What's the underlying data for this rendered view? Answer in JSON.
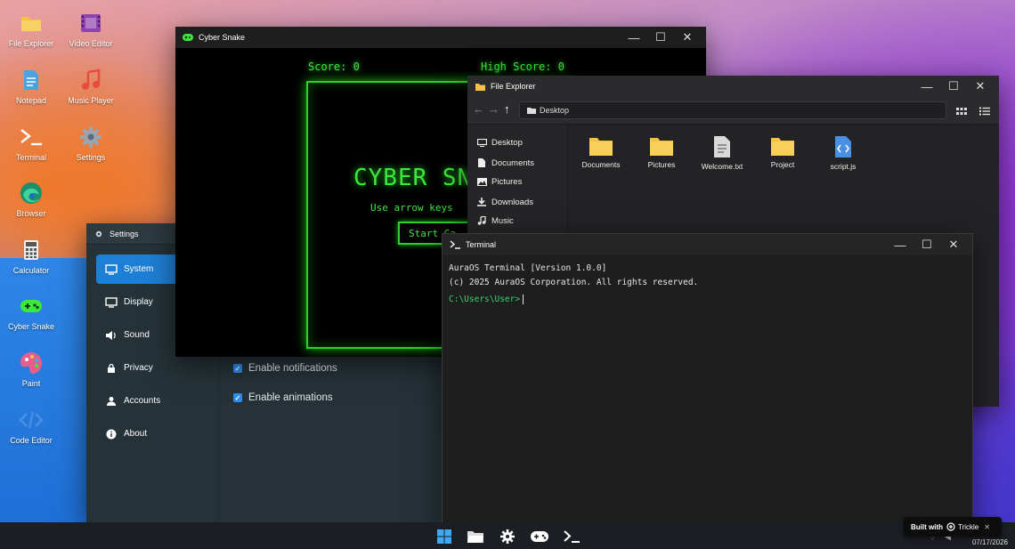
{
  "desktop": {
    "icons": [
      {
        "label": "File Explorer"
      },
      {
        "label": "Video Editor"
      },
      {
        "label": "Notepad"
      },
      {
        "label": "Music Player"
      },
      {
        "label": "Terminal"
      },
      {
        "label": "Settings"
      },
      {
        "label": "Browser"
      },
      {
        "label": "Calculator"
      },
      {
        "label": "Cyber Snake"
      },
      {
        "label": "Paint"
      },
      {
        "label": "Code Editor"
      }
    ]
  },
  "snake": {
    "title": "Cyber Snake",
    "score_label": "Score: 0",
    "high_score_label": "High Score: 0",
    "game_title": "CYBER SN",
    "subtitle": "Use arrow keys",
    "start_label": "Start Ga"
  },
  "settings": {
    "title": "Settings",
    "sidebar": [
      {
        "label": "System",
        "icon": "monitor-icon"
      },
      {
        "label": "Display",
        "icon": "display-icon"
      },
      {
        "label": "Sound",
        "icon": "speaker-icon"
      },
      {
        "label": "Privacy",
        "icon": "lock-icon"
      },
      {
        "label": "Accounts",
        "icon": "user-icon"
      },
      {
        "label": "About",
        "icon": "info-icon"
      }
    ],
    "options": [
      {
        "label": "Enable notifications",
        "checked": true
      },
      {
        "label": "Enable animations",
        "checked": true
      }
    ]
  },
  "explorer": {
    "title": "File Explorer",
    "address": "Desktop",
    "sidebar": [
      {
        "label": "Desktop"
      },
      {
        "label": "Documents"
      },
      {
        "label": "Pictures"
      },
      {
        "label": "Downloads"
      },
      {
        "label": "Music"
      }
    ],
    "files": [
      {
        "name": "Documents",
        "type": "folder"
      },
      {
        "name": "Pictures",
        "type": "folder"
      },
      {
        "name": "Welcome.txt",
        "type": "text"
      },
      {
        "name": "Project",
        "type": "folder"
      },
      {
        "name": "script.js",
        "type": "code"
      }
    ]
  },
  "terminal": {
    "title": "Terminal",
    "lines": [
      "AuraOS Terminal [Version 1.0.0]",
      "(c) 2025 AuraOS Corporation. All rights reserved."
    ],
    "prompt": "C:\\Users\\User>"
  },
  "taskbar": {
    "date": "07/17/2026",
    "time": "",
    "apps": [
      "windows-start-icon",
      "folder-icon",
      "gear-icon",
      "gamepad-icon",
      "terminal-icon"
    ]
  },
  "badge": {
    "built_with": "Built with",
    "brand": "Trickle",
    "close": "✕"
  },
  "colors": {
    "accent": "#1e7fd6",
    "snake_green": "#3ce83c",
    "folder_yellow": "#f5c242",
    "prompt_green": "#3bd16f"
  }
}
